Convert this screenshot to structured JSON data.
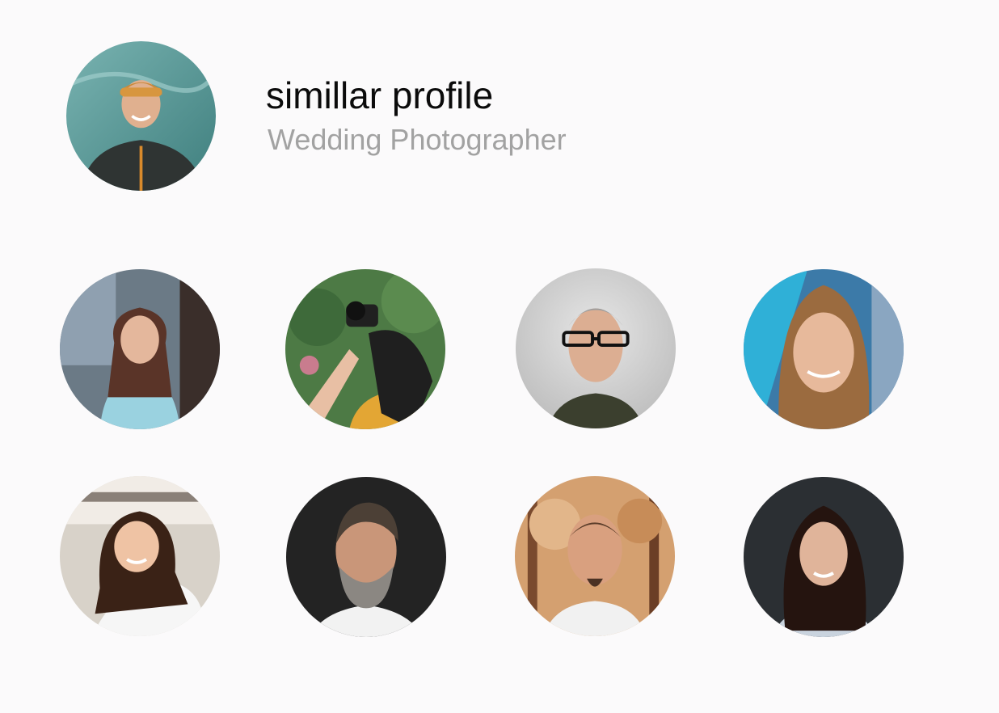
{
  "profile": {
    "name": "simillar profile",
    "role": "Wedding Photographer",
    "avatar_icon": "user-photo-icon"
  },
  "similar_profiles": [
    {
      "icon": "user-photo-icon"
    },
    {
      "icon": "user-photo-icon"
    },
    {
      "icon": "user-photo-icon"
    },
    {
      "icon": "user-photo-icon"
    },
    {
      "icon": "user-photo-icon"
    },
    {
      "icon": "user-photo-icon"
    },
    {
      "icon": "user-photo-icon"
    },
    {
      "icon": "user-photo-icon"
    }
  ],
  "colors": {
    "background": "#fbfafb",
    "name_text": "#0b0b0b",
    "role_text": "#a2a2a2"
  }
}
